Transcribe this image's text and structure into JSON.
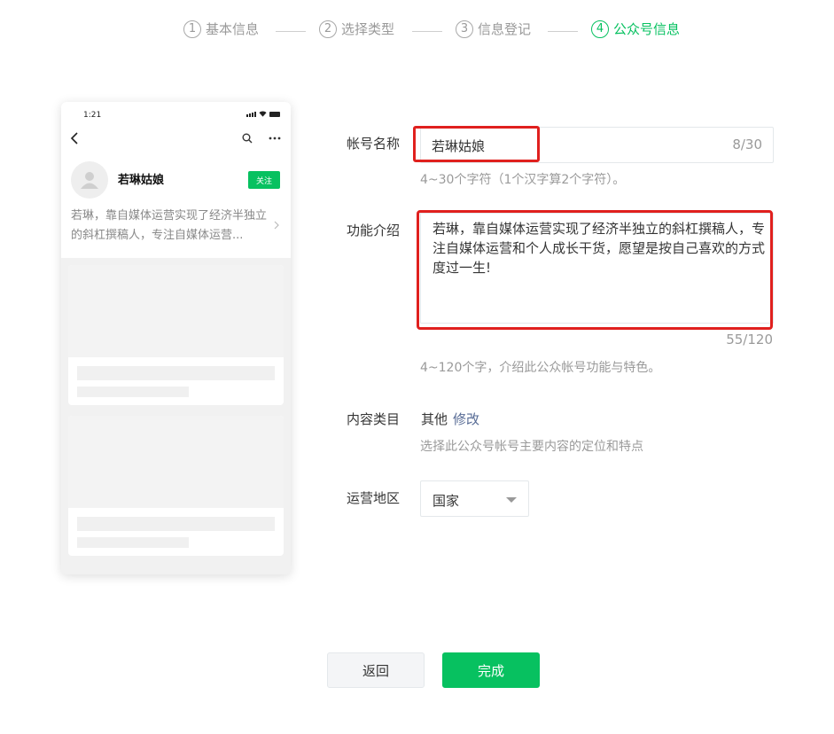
{
  "steps": [
    {
      "num": "1",
      "label": "基本信息"
    },
    {
      "num": "2",
      "label": "选择类型"
    },
    {
      "num": "3",
      "label": "信息登记"
    },
    {
      "num": "4",
      "label": "公众号信息"
    }
  ],
  "phone": {
    "time": "1:21",
    "name": "若琳姑娘",
    "follow_label": "关注",
    "desc": "若琳，靠自媒体运营实现了经济半独立的斜杠撰稿人，专注自媒体运营..."
  },
  "form": {
    "account_name": {
      "label": "帐号名称",
      "value": "若琳姑娘",
      "count": "8/30",
      "tip": "4~30个字符（1个汉字算2个字符）。"
    },
    "intro": {
      "label": "功能介绍",
      "value": "若琳，靠自媒体运营实现了经济半独立的斜杠撰稿人，专注自媒体运营和个人成长干货，愿望是按自己喜欢的方式度过一生!",
      "count": "55/120",
      "tip": "4~120个字，介绍此公众帐号功能与特色。"
    },
    "category": {
      "label": "内容类目",
      "value": "其他",
      "modify_label": "修改",
      "tip": "选择此公众号帐号主要内容的定位和特点"
    },
    "region": {
      "label": "运营地区",
      "value": "国家"
    }
  },
  "buttons": {
    "back_label": "返回",
    "done_label": "完成"
  },
  "colors": {
    "accent": "#07c160",
    "highlight": "#e0201e",
    "link": "#576b95"
  }
}
